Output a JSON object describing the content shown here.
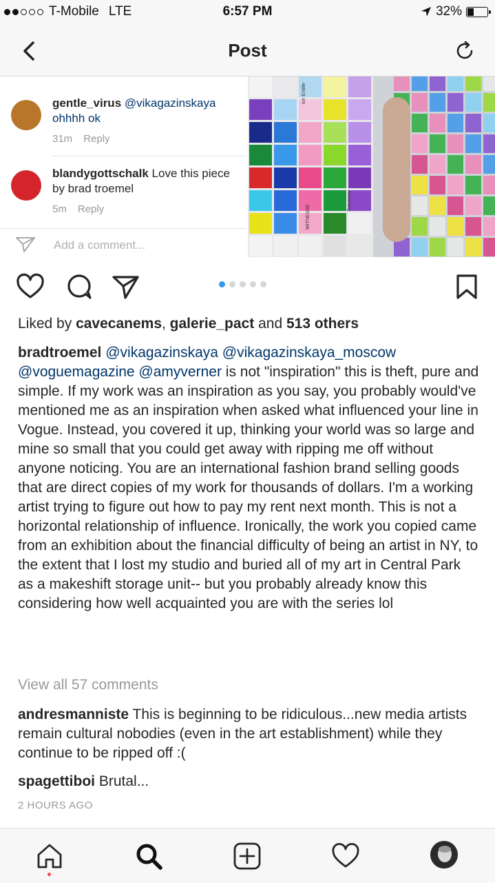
{
  "status_bar": {
    "carrier": "T-Mobile",
    "network": "LTE",
    "time": "6:57 PM",
    "battery_text": "32%",
    "battery_level": 0.32
  },
  "nav": {
    "title": "Post",
    "back_icon": "chevron-left-icon",
    "refresh_icon": "refresh-icon"
  },
  "image_comments": [
    {
      "username": "gentle_virus",
      "text": "@vikagazinskaya ohhhh ok",
      "time": "31m",
      "reply": "Reply",
      "avatar_color": "#b8762a"
    },
    {
      "username": "blandygottschalk",
      "text": "Love this piece by brad troemel",
      "time": "5m",
      "reply": "Reply",
      "avatar_color": "#d4242c"
    }
  ],
  "add_comment_placeholder": "Add a comment...",
  "post": {
    "likes": {
      "prefix": "Liked by ",
      "user1": "cavecanems",
      "sep": ", ",
      "user2": "galerie_pact",
      "and": " and ",
      "others": "513 others"
    },
    "caption": {
      "username": "bradtroemel",
      "mentions": "@vikagazinskaya @vikagazinskaya_moscow @voguemagazine @amyverner",
      "text": " is not \"inspiration\" this is theft, pure and simple. If my work was an inspiration as you say, you probably would've mentioned me as an inspiration when asked what influenced your line in Vogue. Instead, you covered it up, thinking your world was so large and mine so small that you could get away with ripping me off without anyone noticing. You are an international fashion brand selling goods that are direct copies of my work for thousands of dollars. I'm a working artist trying to figure out how to pay my rent next month. This is not a horizontal relationship of influence. Ironically, the work you copied came from an exhibition about the financial difficulty of being an artist in NY, to the extent that I lost my studio and buried all of my art in Central Park as a makeshift storage unit-- but you probably already know this considering how well acquainted you are with the series lol"
    },
    "view_all": "View all 57 comments",
    "comments": [
      {
        "username": "andresmanniste",
        "text": "This is beginning to be ridiculous...new media artists remain cultural nobodies (even in the art establishment) while they continue to be ripped off :("
      },
      {
        "username": "spagettiboi",
        "text": "Brutal..."
      }
    ],
    "time_ago": "2 HOURS AGO",
    "carousel": {
      "count": 5,
      "active": 1
    }
  },
  "art_text": {
    "label1": "ion Entitle",
    "label2": "WITNESSE",
    "label3": "Tomorrow"
  },
  "colors": {
    "link": "#003569",
    "accent_blue": "#3897f0",
    "notification_red": "#ed4956"
  },
  "tabs": [
    "home-icon",
    "search-icon",
    "add-post-icon",
    "activity-heart-icon",
    "profile-avatar"
  ]
}
